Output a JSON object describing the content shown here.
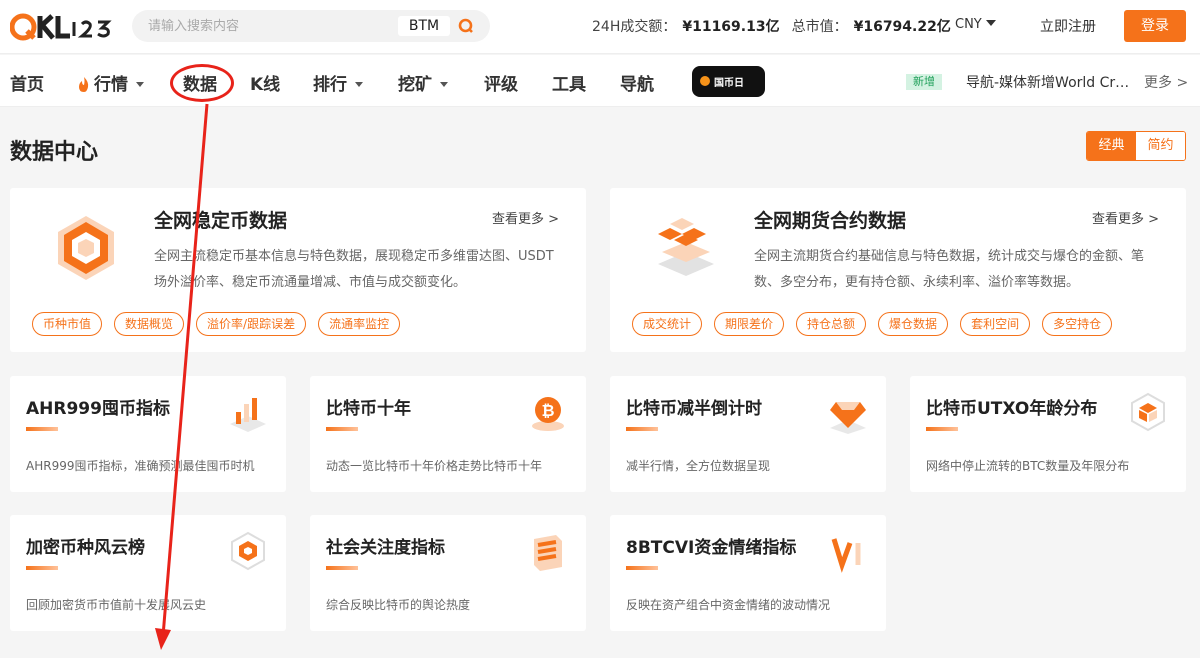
{
  "header": {
    "logo_text": "QKL123",
    "search": {
      "placeholder": "请输入搜索内容",
      "coin": "BTM"
    },
    "stats": {
      "volume_label": "24H成交额：",
      "volume_value": "¥11169.13亿",
      "cap_label": "总市值：",
      "cap_value": "¥16794.22亿"
    },
    "currency": "CNY",
    "signup": "立即注册",
    "login": "登录"
  },
  "nav": {
    "items": [
      "首页",
      "行情",
      "数据",
      "K线",
      "排行",
      "挖矿",
      "评级",
      "工具",
      "导航"
    ],
    "promo": "国币日",
    "news_badge": "新增",
    "news_text": "导航-媒体新增World Crypto",
    "more": "更多 >"
  },
  "page": {
    "title": "数据中心",
    "toggle": {
      "classic": "经典",
      "simple": "简约"
    }
  },
  "big_cards": [
    {
      "title": "全网稳定币数据",
      "see_more": "查看更多 >",
      "desc": "全网主流稳定币基本信息与特色数据，展现稳定币多维雷达图、USDT场外溢价率、稳定币流通量增减、市值与成交额变化。",
      "tags": [
        "币种市值",
        "数据概览",
        "溢价率/跟踪误差",
        "流通率监控"
      ]
    },
    {
      "title": "全网期货合约数据",
      "see_more": "查看更多 >",
      "desc": "全网主流期货合约基础信息与特色数据，统计成交与爆仓的金额、笔数、多空分布，更有持仓额、永续利率、溢价率等数据。",
      "tags": [
        "成交统计",
        "期限差价",
        "持仓总额",
        "爆仓数据",
        "套利空间",
        "多空持仓"
      ]
    }
  ],
  "small_cards": [
    {
      "title": "AHR999囤币指标",
      "desc": "AHR999囤币指标，准确预测最佳囤币时机"
    },
    {
      "title": "比特币十年",
      "desc": "动态一览比特币十年价格走势比特币十年"
    },
    {
      "title": "比特币减半倒计时",
      "desc": "减半行情，全方位数据呈现"
    },
    {
      "title": "比特币UTXO年龄分布",
      "desc": "网络中停止流转的BTC数量及年限分布"
    },
    {
      "title": "加密币种风云榜",
      "desc": "回顾加密货币市值前十发展风云史"
    },
    {
      "title": "社会关注度指标",
      "desc": "综合反映比特币的舆论热度"
    },
    {
      "title": "8BTCVI资金情绪指标",
      "desc": "反映在资产组合中资金情绪的波动情况"
    }
  ],
  "colors": {
    "accent": "#f5721a",
    "annotation": "#e8231a"
  }
}
